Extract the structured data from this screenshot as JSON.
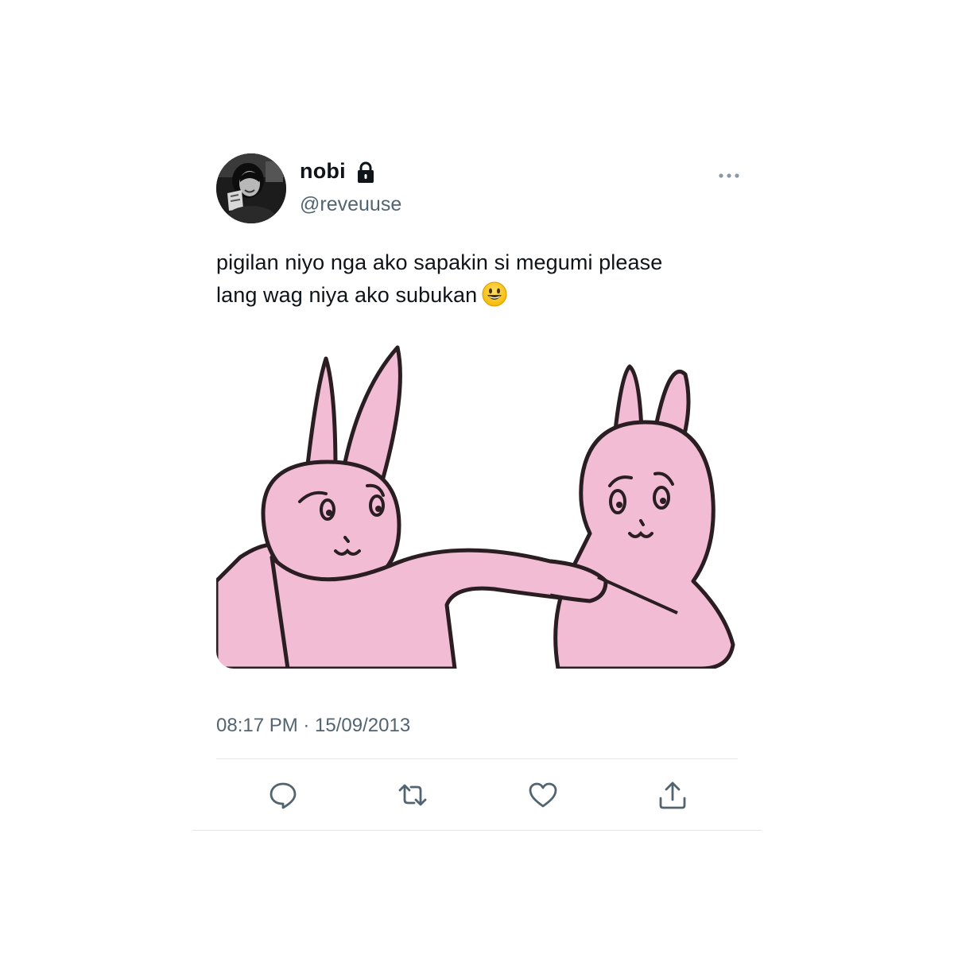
{
  "tweet": {
    "author": {
      "display_name": "nobi",
      "handle": "@reveuuse",
      "protected": true,
      "avatar_icon": "profile-photo-grayscale"
    },
    "text_line1": "pigilan niyo nga ako sapakin si megumi please",
    "text_line2": "lang wag niya ako subukan",
    "emoji": "smiling-face-emoji",
    "media": {
      "description_icon": "pink-bunny-meme-image",
      "colors": {
        "bunny_fill": "#f2bcd5",
        "outline": "#2a1e22",
        "background": "#ffffff"
      }
    },
    "timestamp": "08:17 PM · 15/09/2013",
    "actions": [
      "reply-icon",
      "retweet-icon",
      "like-icon",
      "share-icon"
    ]
  },
  "colors": {
    "text": "#0f1419",
    "secondary": "#536471",
    "divider": "#e3e6e8"
  }
}
